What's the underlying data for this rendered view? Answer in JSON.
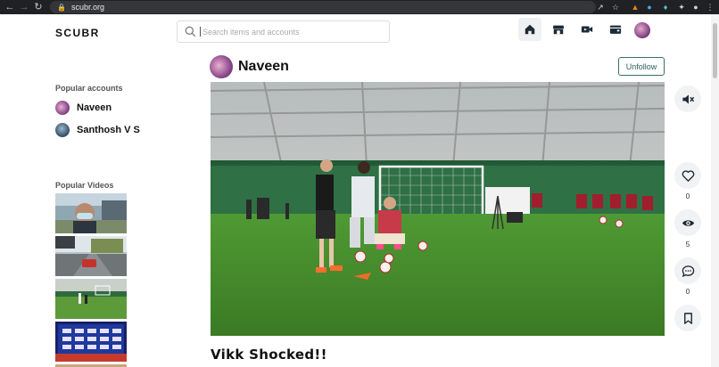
{
  "browser": {
    "url": "scubr.org"
  },
  "header": {
    "logo": "SCUBR",
    "search_placeholder": "Search items and accounts"
  },
  "sidebar": {
    "popular_accounts_title": "Popular accounts",
    "accounts": [
      {
        "name": "Naveen"
      },
      {
        "name": "Santhosh V S"
      }
    ],
    "popular_videos_title": "Popular Videos"
  },
  "post": {
    "author": "Naveen",
    "follow_label": "Unfollow",
    "title": "Vikk Shocked!!",
    "likes": "0",
    "views": "5",
    "comments": "0"
  },
  "colors": {
    "accent": "#2d5e5a",
    "field": "#3f8a2a",
    "chrome": "#202124"
  }
}
